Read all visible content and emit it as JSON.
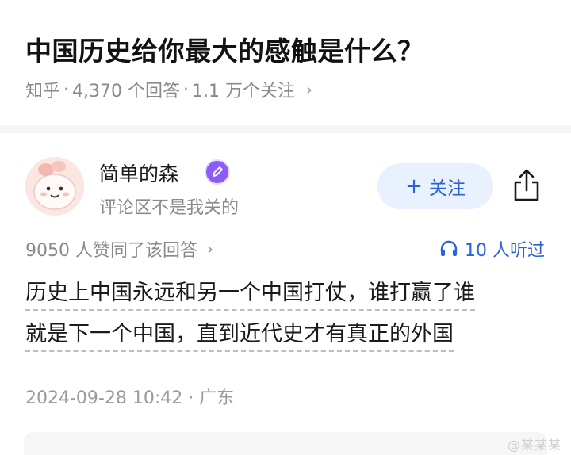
{
  "question": {
    "title": "中国历史给你最大的感触是什么？",
    "source": "知乎",
    "separator": "·",
    "answers": "4,370 个回答",
    "followers": "1.1 万个关注",
    "chevron": "›"
  },
  "author": {
    "name": "简单的森",
    "signature": "评论区不是我关的",
    "badge_icon": "pen-badge-icon",
    "follow_plus": "+",
    "follow_label": "关注"
  },
  "stats": {
    "agree_text": "9050 人赞同了该回答",
    "chevron": "›",
    "listen_text": "10 人听过"
  },
  "answer": {
    "lines": [
      "历史上中国永远和另一个中国打仗，谁打赢了谁",
      "就是下一个中国，直到近代史才有真正的外国"
    ]
  },
  "meta": {
    "timestamp": "2024-09-28 10:42 · 广东"
  },
  "watermark": "@某某某",
  "colors": {
    "accent": "#2a63d8",
    "follow_bg": "#e8f1fd",
    "badge": "#8b5cf6",
    "muted": "#8a8a8a"
  }
}
